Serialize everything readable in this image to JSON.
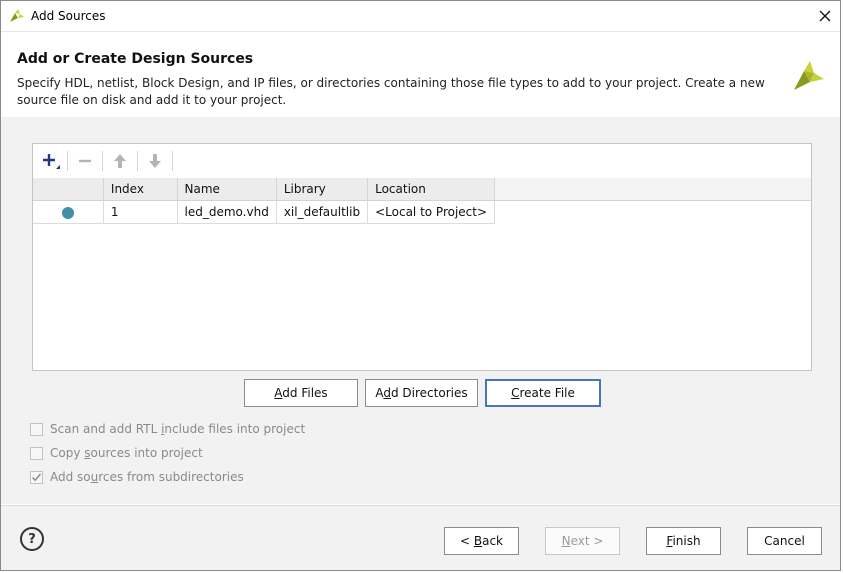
{
  "window": {
    "title": "Add Sources"
  },
  "header": {
    "title": "Add or Create Design Sources",
    "description": "Specify HDL, netlist, Block Design, and IP files, or directories containing those file types to add to your project. Create a new source file on disk and add it to your project."
  },
  "table": {
    "columns": [
      "",
      "Index",
      "Name",
      "Library",
      "Location"
    ],
    "rows": [
      {
        "index": "1",
        "name": "led_demo.vhd",
        "library": "xil_defaultlib",
        "location": "<Local to Project>"
      }
    ]
  },
  "buttons": {
    "add_files": {
      "pre": "",
      "mnemonic": "A",
      "post": "dd Files"
    },
    "add_directories": {
      "pre": "A",
      "mnemonic": "d",
      "post": "d Directories"
    },
    "create_file": {
      "pre": "",
      "mnemonic": "C",
      "post": "reate File"
    }
  },
  "options": {
    "scan_rtl": {
      "pre": "Scan and add RTL ",
      "mnemonic": "i",
      "post": "nclude files into project",
      "checked": false
    },
    "copy_sources": {
      "pre": "Copy ",
      "mnemonic": "s",
      "post": "ources into project",
      "checked": false
    },
    "add_subdirs": {
      "pre": "Add so",
      "mnemonic": "u",
      "post": "rces from subdirectories",
      "checked": true
    }
  },
  "footer": {
    "help": "?",
    "back": {
      "pre": "< ",
      "mnemonic": "B",
      "post": "ack"
    },
    "next": {
      "pre": "",
      "mnemonic": "N",
      "post": "ext >"
    },
    "finish": {
      "pre": "",
      "mnemonic": "F",
      "post": "inish"
    },
    "cancel": "Cancel"
  },
  "colors": {
    "accent": "#4a74b8",
    "status_dot": "#3f8fa5",
    "logo_dark": "#8a9a1e",
    "logo_light": "#c6d33a"
  },
  "icons": {
    "add": "plus-icon",
    "remove": "minus-icon",
    "up": "arrow-up-icon",
    "down": "arrow-down-icon",
    "close": "close-icon"
  }
}
